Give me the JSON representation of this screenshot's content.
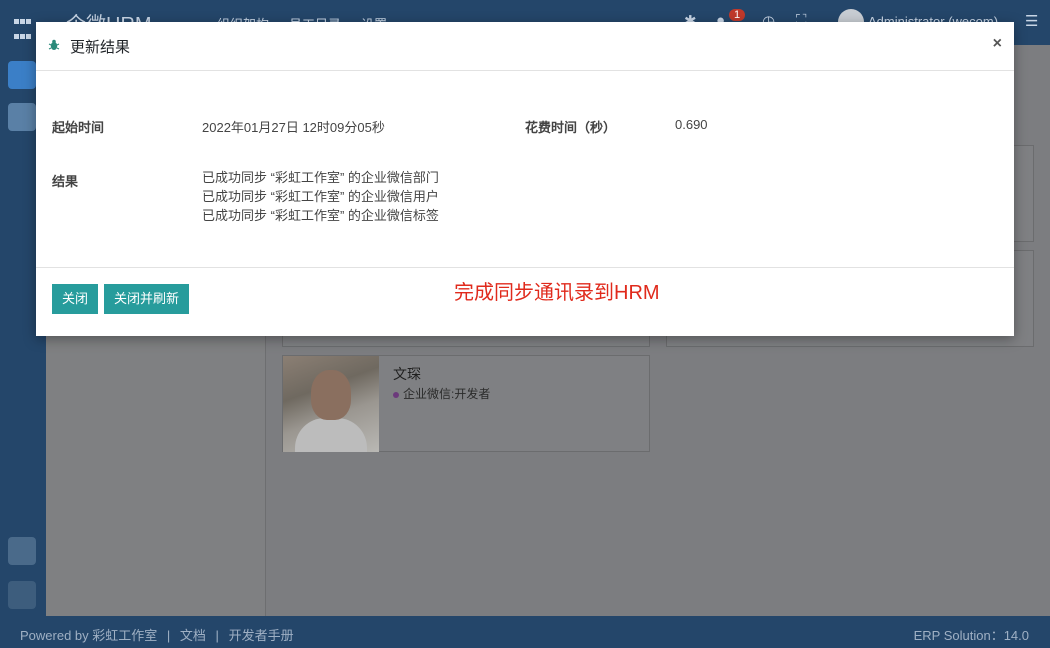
{
  "topbar": {
    "brand": "企微HRM",
    "menu": [
      "组织架构",
      "员工目录",
      "设置"
    ],
    "notification_count": "1",
    "user": "Administrator (wecom)"
  },
  "employee_card": {
    "name": "文琛",
    "tag": "企业微信:开发者"
  },
  "footer": {
    "powered_by": "Powered by 彩虹工作室",
    "sep": "|",
    "docs": "文档",
    "dev_manual": "开发者手册",
    "version": "ERP Solution：14.0"
  },
  "modal": {
    "title": "更新结果",
    "close_symbol": "×",
    "start_time_label": "起始时间",
    "start_time_value": "2022年01月27日 12时09分05秒",
    "duration_label": "花费时间（秒）",
    "duration_value": "0.690",
    "result_label": "结果",
    "results": [
      "已成功同步 “彩虹工作室” 的企业微信部门",
      "已成功同步 “彩虹工作室” 的企业微信用户",
      "已成功同步 “彩虹工作室” 的企业微信标签"
    ],
    "close_button": "关闭",
    "close_refresh_button": "关闭并刷新",
    "annotation": "完成同步通讯录到HRM"
  },
  "colors": {
    "primary_button": "#279c9c",
    "annotation": "#e02a1c",
    "navbar": "#24466a"
  }
}
